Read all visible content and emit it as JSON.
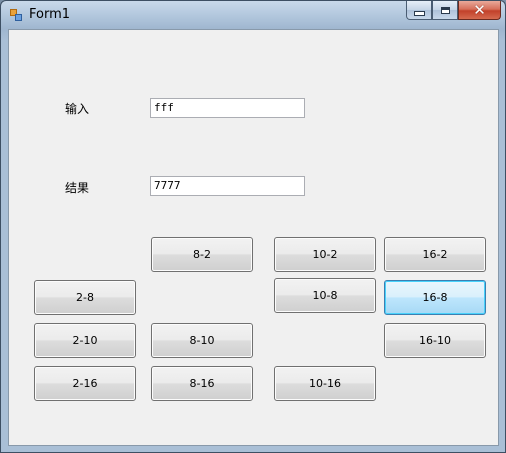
{
  "window": {
    "title": "Form1"
  },
  "form": {
    "input_label": "输入",
    "input_value": "fff",
    "result_label": "结果",
    "result_value": "7777"
  },
  "buttons": {
    "b8_2": "8-2",
    "b10_2": "10-2",
    "b16_2": "16-2",
    "b2_8": "2-8",
    "b10_8": "10-8",
    "b16_8": "16-8",
    "b2_10": "2-10",
    "b8_10": "8-10",
    "b16_10": "16-10",
    "b2_16": "2-16",
    "b8_16": "8-16",
    "b10_16": "10-16"
  },
  "icons": {
    "app": "form-app-icon",
    "minimize": "minimize-icon",
    "maximize": "maximize-icon",
    "close": "close-icon"
  },
  "colors": {
    "client_background": "#f0f0f0",
    "focused_button_border": "#3c7fb1",
    "close_button": "#c2412a"
  }
}
